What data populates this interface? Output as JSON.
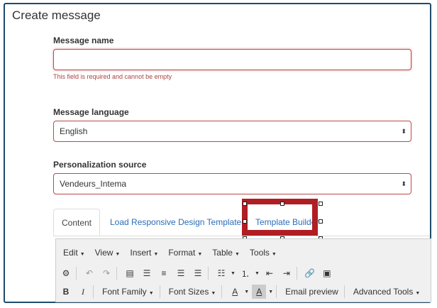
{
  "page": {
    "title": "Create message"
  },
  "fields": {
    "name": {
      "label": "Message name",
      "value": "",
      "error": "This field is required and cannot be empty"
    },
    "language": {
      "label": "Message language",
      "value": "English"
    },
    "source": {
      "label": "Personalization source",
      "value": "Vendeurs_Intema"
    }
  },
  "tabs": [
    {
      "label": "Content"
    },
    {
      "label": "Load Responsive Design Template"
    },
    {
      "label": "Template Builder"
    }
  ],
  "editor": {
    "menus": [
      "Edit",
      "View",
      "Insert",
      "Format",
      "Table",
      "Tools"
    ],
    "toolbar2": {
      "font_family": "Font Family",
      "font_sizes": "Font Sizes",
      "email_preview": "Email preview",
      "advanced_tools": "Advanced Tools"
    }
  },
  "colors": {
    "error": "#b94a48",
    "highlight": "#b01d22",
    "link": "#2a6eb8"
  }
}
